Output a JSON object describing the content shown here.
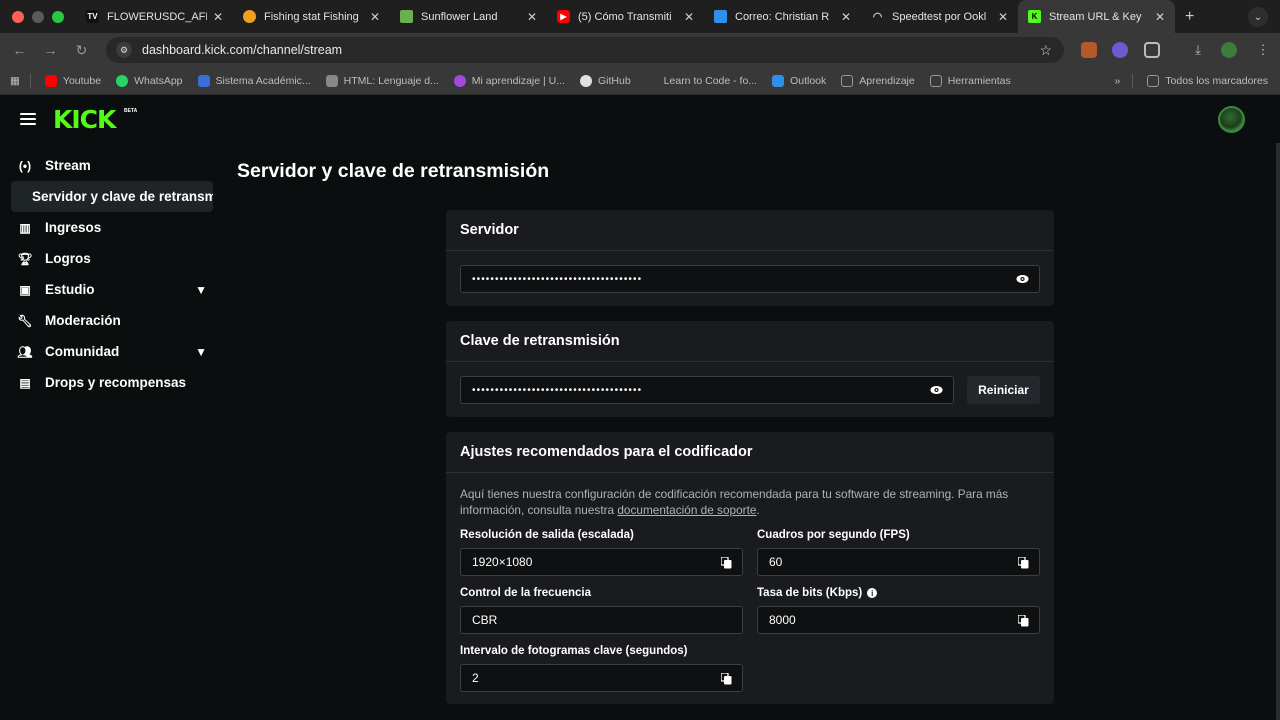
{
  "browser": {
    "tabs": [
      {
        "label": "FLOWERUSDC_AFE",
        "icon": "tradingview-icon",
        "color": "#ffffff"
      },
      {
        "label": "Fishing stat Fishing",
        "icon": "gear-sun-icon",
        "color": "#f0a020"
      },
      {
        "label": "Sunflower Land",
        "icon": "sunflower-icon",
        "color": "#6ab04c"
      },
      {
        "label": "(5) Cómo Transmiti",
        "icon": "youtube-icon",
        "color": "#ff0000"
      },
      {
        "label": "Correo: Christian R",
        "icon": "outlook-icon",
        "color": "#2f8fe8"
      },
      {
        "label": "Speedtest por Ookl",
        "icon": "speedtest-icon",
        "color": "#cccccc"
      },
      {
        "label": "Stream URL & Key",
        "icon": "kick-icon",
        "color": "#53fc18"
      }
    ],
    "url": "dashboard.kick.com/channel/stream",
    "bookmarks": [
      {
        "label": "Youtube",
        "color": "#ff0000"
      },
      {
        "label": "WhatsApp",
        "color": "#25d366"
      },
      {
        "label": "Sistema Académic...",
        "color": "#3b6fd8"
      },
      {
        "label": "HTML: Lenguaje d...",
        "color": "#888888"
      },
      {
        "label": "Mi aprendizaje | U...",
        "color": "#a349d8"
      },
      {
        "label": "GitHub",
        "color": "#e0e0e0"
      },
      {
        "label": "Learn to Code - fo...",
        "color": "#383838"
      },
      {
        "label": "Outlook",
        "color": "#2f8fe8"
      },
      {
        "label": "Aprendizaje",
        "color": "#9a9a9a"
      },
      {
        "label": "Herramientas",
        "color": "#9a9a9a"
      }
    ],
    "bookmarks_overflow": "»",
    "all_bookmarks": "Todos los marcadores"
  },
  "app": {
    "logo": "KICK",
    "logo_badge": "BETA",
    "accent": "#53fc18"
  },
  "sidebar": {
    "items": [
      {
        "label": "Stream",
        "icon": "stream-icon"
      },
      {
        "label": "Ingresos",
        "icon": "chart-icon"
      },
      {
        "label": "Logros",
        "icon": "trophy-icon"
      },
      {
        "label": "Estudio",
        "icon": "studio-icon"
      },
      {
        "label": "Moderación",
        "icon": "wrench-icon"
      },
      {
        "label": "Comunidad",
        "icon": "community-icon"
      },
      {
        "label": "Drops y recompensas",
        "icon": "drops-icon"
      }
    ],
    "sub_item": "Servidor y clave de retransmisión"
  },
  "main": {
    "title": "Servidor y clave de retransmisión",
    "server": {
      "heading": "Servidor",
      "value": "•••••••••••••••••••••••••••••••••••••"
    },
    "stream_key": {
      "heading": "Clave de retransmisión",
      "value": "•••••••••••••••••••••••••••••••••••••",
      "reset_label": "Reiniciar"
    },
    "encoder": {
      "heading": "Ajustes recomendados para el codificador",
      "desc_pre": "Aquí tienes nuestra configuración de codificación recomendada para tu software de streaming. Para más información, consulta nuestra ",
      "desc_link": "documentación de soporte",
      "desc_post": ".",
      "resolution_label": "Resolución de salida (escalada)",
      "resolution_value": "1920×1080",
      "fps_label": "Cuadros por segundo (FPS)",
      "fps_value": "60",
      "rate_control_label": "Control de la frecuencia",
      "rate_control_value": "CBR",
      "bitrate_label": "Tasa de bits (Kbps)",
      "bitrate_value": "8000",
      "keyframe_label": "Intervalo de fotogramas clave (segundos)",
      "keyframe_value": "2"
    }
  }
}
